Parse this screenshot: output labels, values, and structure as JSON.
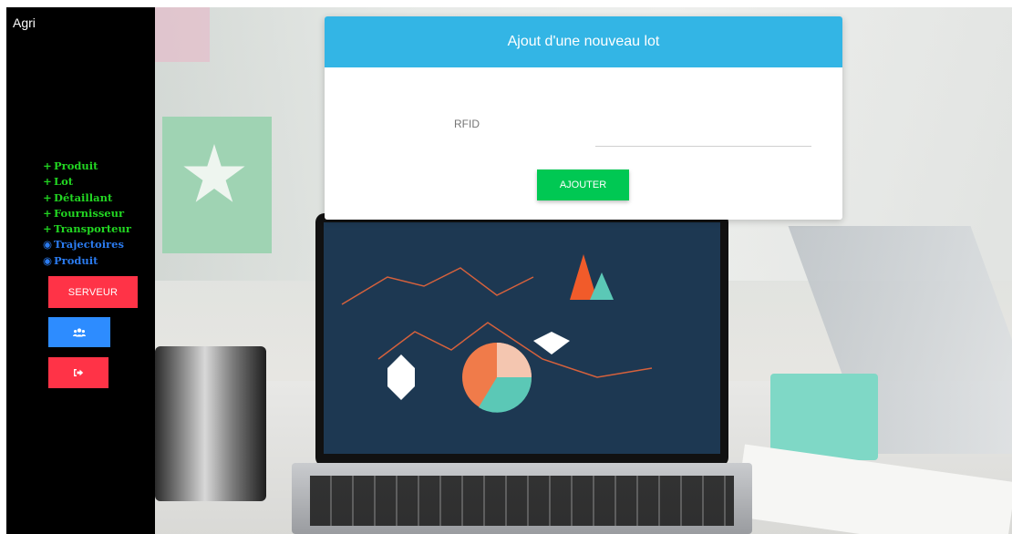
{
  "app": {
    "title": "Agri"
  },
  "sidebar": {
    "nav": [
      {
        "symbol": "+",
        "label": "Produit",
        "kind": "add",
        "icon": "plus-icon"
      },
      {
        "symbol": "+",
        "label": "Lot",
        "kind": "add",
        "icon": "plus-icon"
      },
      {
        "symbol": "+",
        "label": "Détaillant",
        "kind": "add",
        "icon": "plus-icon"
      },
      {
        "symbol": "+",
        "label": "Fournisseur",
        "kind": "add",
        "icon": "plus-icon"
      },
      {
        "symbol": "+",
        "label": "Transporteur",
        "kind": "add",
        "icon": "plus-icon"
      },
      {
        "symbol": "◉",
        "label": "Trajectoires",
        "kind": "view",
        "icon": "eye-icon"
      },
      {
        "symbol": "◉",
        "label": "Produit",
        "kind": "view",
        "icon": "eye-icon"
      }
    ],
    "serveur_button": "SERVEUR",
    "users_icon": "users-icon",
    "logout_icon": "sign-out-icon"
  },
  "form": {
    "title": "Ajout d'une nouveau lot",
    "rfid_label": "RFID",
    "rfid_value": "",
    "submit_label": "AJOUTER"
  },
  "colors": {
    "sidebar_bg": "#000000",
    "add_link": "#22d622",
    "view_link": "#2b7bef",
    "danger_button": "#ff3347",
    "primary_button": "#2d8cff",
    "header": "#33b5e5",
    "submit": "#00c853"
  }
}
